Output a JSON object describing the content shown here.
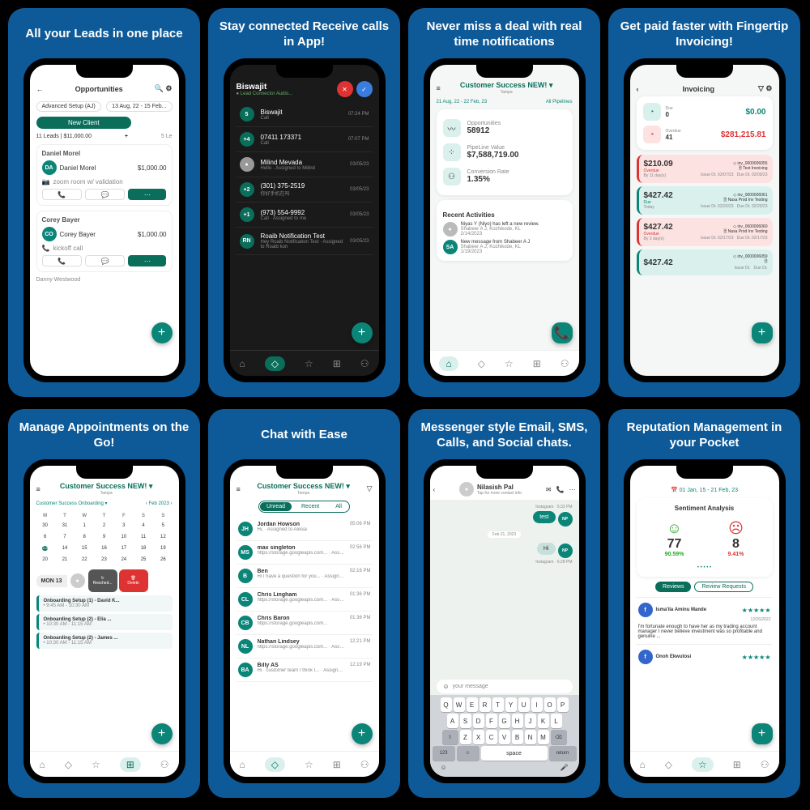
{
  "cards": [
    {
      "title": "All your Leads in one place"
    },
    {
      "title": "Stay connected Receive calls in App!"
    },
    {
      "title": "Never miss a deal with real time notifications"
    },
    {
      "title": "Get paid faster with Fingertip Invoicing!"
    },
    {
      "title": "Manage Appointments on the Go!"
    },
    {
      "title": "Chat with Ease"
    },
    {
      "title": "Messenger style Email, SMS, Calls, and Social chats."
    },
    {
      "title": "Reputation Management in your Pocket"
    }
  ],
  "opportunities": {
    "header": "Opportunities",
    "filter1": "Advanced Setup (AJ)",
    "filter2": "13 Aug, 22 - 15 Feb...",
    "tab": "New Client",
    "summary": "11 Leads | $11,000.00",
    "other_summary": "5 Le",
    "leads": [
      {
        "name": "Daniel Morel",
        "initials": "DA",
        "amount": "$1,000.00",
        "status": "zoom room w/ validation"
      },
      {
        "name": "Corey Bayer",
        "initials": "CO",
        "amount": "$1,000.00",
        "status": "kickoff call"
      }
    ],
    "footer_name": "Danny Westwood"
  },
  "calls": {
    "header": "Biswajit",
    "sub": "Lead Connector Audio...",
    "items": [
      {
        "name": "Biswajit",
        "sub": "Call",
        "time": "07:24 PM",
        "badge": "5"
      },
      {
        "name": "07411 173371",
        "sub": "Call",
        "time": "07:07 PM",
        "badge": "+4"
      },
      {
        "name": "Milind Mevada",
        "sub": "Hello · Assigned to Milind",
        "time": "03/05/23",
        "avatar": true
      },
      {
        "name": "(301) 375-2519",
        "sub": "你好手机在吗",
        "time": "03/05/23",
        "badge": "+2"
      },
      {
        "name": "(973) 554-9992",
        "sub": "Call · Assigned to me",
        "time": "03/05/23",
        "badge": "+1"
      },
      {
        "name": "Roaib Notification Test",
        "sub": "Hey Roaib Notification Test · Assigned to Roaib kon",
        "time": "03/05/23",
        "badge": "RN"
      }
    ]
  },
  "dashboard": {
    "account": "Customer Success NEW!",
    "location": "Tampa",
    "date_filter": "21 Aug, 22 - 22 Feb, 23",
    "pipeline_filter": "All Pipelines",
    "stats": [
      {
        "label": "Opportunities",
        "value": "58912"
      },
      {
        "label": "PipeLine Value",
        "value": "$7,588,719.00"
      },
      {
        "label": "Conversion Rate",
        "value": "1.35%"
      }
    ],
    "recent_title": "Recent Activities",
    "activities": [
      {
        "text": "Niyas Y (Niyo) has left a new review.",
        "sub": "Shabeer A J, Kozhikode, KL",
        "date": "2/14/2023"
      },
      {
        "text": "New message from Shabeer A J",
        "sub": "Shabeer A J, Kozhikode, KL",
        "date": "1/19/2023",
        "initials": "SA"
      }
    ]
  },
  "invoicing": {
    "header": "Invoicing",
    "due_label": "Due",
    "due_count": "0",
    "due_amount": "$0.00",
    "overdue_label": "Overdue",
    "overdue_count": "41",
    "overdue_amount": "$281,215.81",
    "invoices": [
      {
        "amount": "$210.09",
        "status": "Overdue",
        "by": "By 11 day(s)",
        "id": "inv_0000006055",
        "name": "Test Invoicing",
        "issue": "02/07/23",
        "due": "02/09/23",
        "type": "overdue"
      },
      {
        "amount": "$427.42",
        "status": "Due",
        "by": "Today",
        "id": "inv_0000006061",
        "name": "Nasa Prod Inv Testing",
        "issue": "02/20/23",
        "due": "02/20/23",
        "type": "due"
      },
      {
        "amount": "$427.42",
        "status": "Overdue",
        "by": "By 3 day(s)",
        "id": "inv_0000006060",
        "name": "Nasa Prod Inv Testing",
        "issue": "02/17/23",
        "due": "02/17/23",
        "type": "overdue"
      },
      {
        "amount": "$427.42",
        "status": "",
        "by": "",
        "id": "inv_0000006059",
        "name": "",
        "issue": "",
        "due": "",
        "type": "due"
      }
    ]
  },
  "appointments": {
    "account": "Customer Success NEW!",
    "location": "Tampa",
    "cal_filter": "Customer Success Onboarding",
    "month": "Feb 2023",
    "days": [
      "M",
      "T",
      "W",
      "T",
      "F",
      "S",
      "S"
    ],
    "dates": [
      "30",
      "31",
      "1",
      "2",
      "3",
      "4",
      "5",
      "6",
      "7",
      "8",
      "9",
      "10",
      "11",
      "12",
      "13",
      "14",
      "15",
      "16",
      "17",
      "18",
      "19",
      "20",
      "21",
      "22",
      "23",
      "24",
      "25",
      "26"
    ],
    "today_index": 14,
    "selected_day": "MON 13",
    "swipe": {
      "resched": "Resched...",
      "delete": "Delete"
    },
    "items": [
      {
        "title": "Onboarding Setup (1) - David K...",
        "time": "9:45 AM - 10:30 AM"
      },
      {
        "title": "Onboarding Setup (2) - Elia ...",
        "time": "10:30 AM - 11:15 AM"
      },
      {
        "title": "Onboarding Setup (2) - James ...",
        "time": "10:30 AM - 11:15 AM"
      }
    ]
  },
  "chat_list": {
    "account": "Customer Success NEW!",
    "location": "Tampa",
    "tabs": [
      "Unread",
      "Recent",
      "All"
    ],
    "active_tab": 0,
    "items": [
      {
        "initials": "JH",
        "name": "Jordan Howson",
        "msg": "Hi, · Assigned to Alesia",
        "time": "05:06 PM"
      },
      {
        "initials": "MS",
        "name": "max singleton",
        "msg": "https://storage.googleapis.com... · Assigned to Deanna",
        "time": "02:56 PM"
      },
      {
        "initials": "B",
        "name": "Ben",
        "msg": "Hi I have a question for you... · Assigned to Erica",
        "time": "02:16 PM"
      },
      {
        "initials": "CL",
        "name": "Chris Lingham",
        "msg": "https://storage.googleapis.com... · Assigned to Nica",
        "time": "01:36 PM"
      },
      {
        "initials": "CB",
        "name": "Chris Baron",
        "msg": "https://storage.googleapis.com...",
        "time": "01:36 PM"
      },
      {
        "initials": "NL",
        "name": "Nathan Lindsey",
        "msg": "https://storage.googleapis.com... · Assigned to Ryan",
        "time": "12:21 PM"
      },
      {
        "initials": "BA",
        "name": "Billy AS",
        "msg": "Hi · customer team I think I... · Assigned to James",
        "time": "12:19 PM"
      }
    ]
  },
  "messenger": {
    "contact": "Nilasish Pal",
    "contact_sub": "Tap for more contact info",
    "date1": "Instagram · 5:32 PM",
    "bubble_out1": "test",
    "date_sep": "Feb 21, 2023",
    "bubble_out2": "Hi",
    "date2": "Instagram · 6:28 PM",
    "badge": "NP",
    "compose_placeholder": "your message",
    "keyboard": {
      "row1": [
        "Q",
        "W",
        "E",
        "R",
        "T",
        "Y",
        "U",
        "I",
        "O",
        "P"
      ],
      "row2": [
        "A",
        "S",
        "D",
        "F",
        "G",
        "H",
        "J",
        "K",
        "L"
      ],
      "row3": [
        "⇧",
        "Z",
        "X",
        "C",
        "V",
        "B",
        "N",
        "M",
        "⌫"
      ],
      "row4_123": "123",
      "row4_space": "space",
      "row4_return": "return"
    }
  },
  "reputation": {
    "date_filter": "01 Jan, 15 - 21 Feb, 23",
    "title": "Sentiment Analysis",
    "positive": {
      "count": "77",
      "pct": "90.59%"
    },
    "negative": {
      "count": "8",
      "pct": "9.41%"
    },
    "tabs": [
      "Reviews",
      "Review Requests"
    ],
    "active_tab": 0,
    "reviews": [
      {
        "name": "Isma'ila Aminu Mande",
        "stars": "★★★★★",
        "date": "12/26/2022",
        "text": "I'm fortunate enough to have her as my trading account manager I never believe investment was so profitable and genuine ..."
      },
      {
        "name": "Onoh Ekwutosi",
        "stars": "★★★★★",
        "date": "",
        "text": ""
      }
    ]
  },
  "nav_icons": [
    "⌂",
    "◇",
    "☆",
    "⊞",
    "⚇"
  ]
}
